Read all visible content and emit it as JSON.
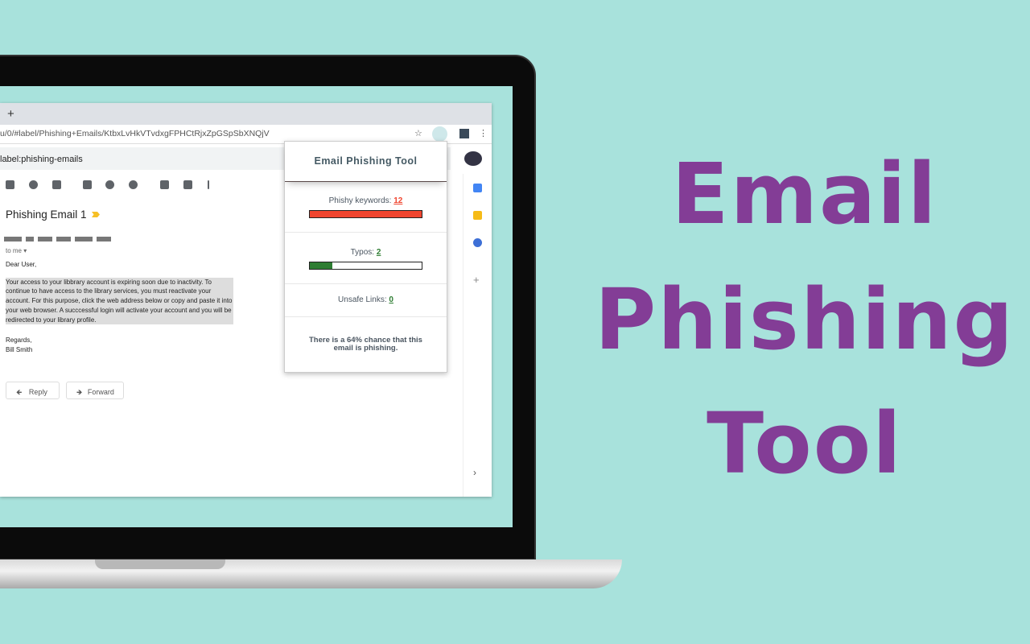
{
  "browser": {
    "url": "u/0/#label/Phishing+Emails/KtbxLvHkVTvdxgFPHCtRjxZpGSpSbXNQjV",
    "new_tab": "+",
    "star_icon": "☆",
    "menu_icon": "⋮"
  },
  "gmail": {
    "search": "label:phishing-emails",
    "subject": "Phishing Email 1",
    "to": "to me ▾",
    "body": {
      "greeting": "Dear User,",
      "paragraph": "Your access to your libbrary account is expiring soon due to inactivity. To continue to have access to the library services, you must reactivate your account. For this purpose, click the web address below or copy and paste it into your web browser. A succcessful login will activate your account and you will be redirected to your library profile.",
      "closing": "Regards,",
      "signature": "Bill Smith"
    },
    "reply": "Reply",
    "forward": "Forward",
    "reply_icon": "🡸",
    "forward_icon": "🡺"
  },
  "popup": {
    "title": "Email Phishing Tool",
    "keywords": {
      "label": "Phishy keywords: ",
      "value": "12",
      "fill_percent": 100,
      "color": "#f0452f"
    },
    "typos": {
      "label": "Typos: ",
      "value": "2",
      "fill_percent": 20,
      "color": "#2e7d32"
    },
    "links": {
      "label": "Unsafe Links: ",
      "value": "0",
      "color": "#2e7d32"
    },
    "verdict": "There is a 64% chance that this email is phishing."
  },
  "hero": {
    "line1": "Email",
    "line2": "Phishing",
    "line3": "Tool",
    "color": "#833d96"
  }
}
